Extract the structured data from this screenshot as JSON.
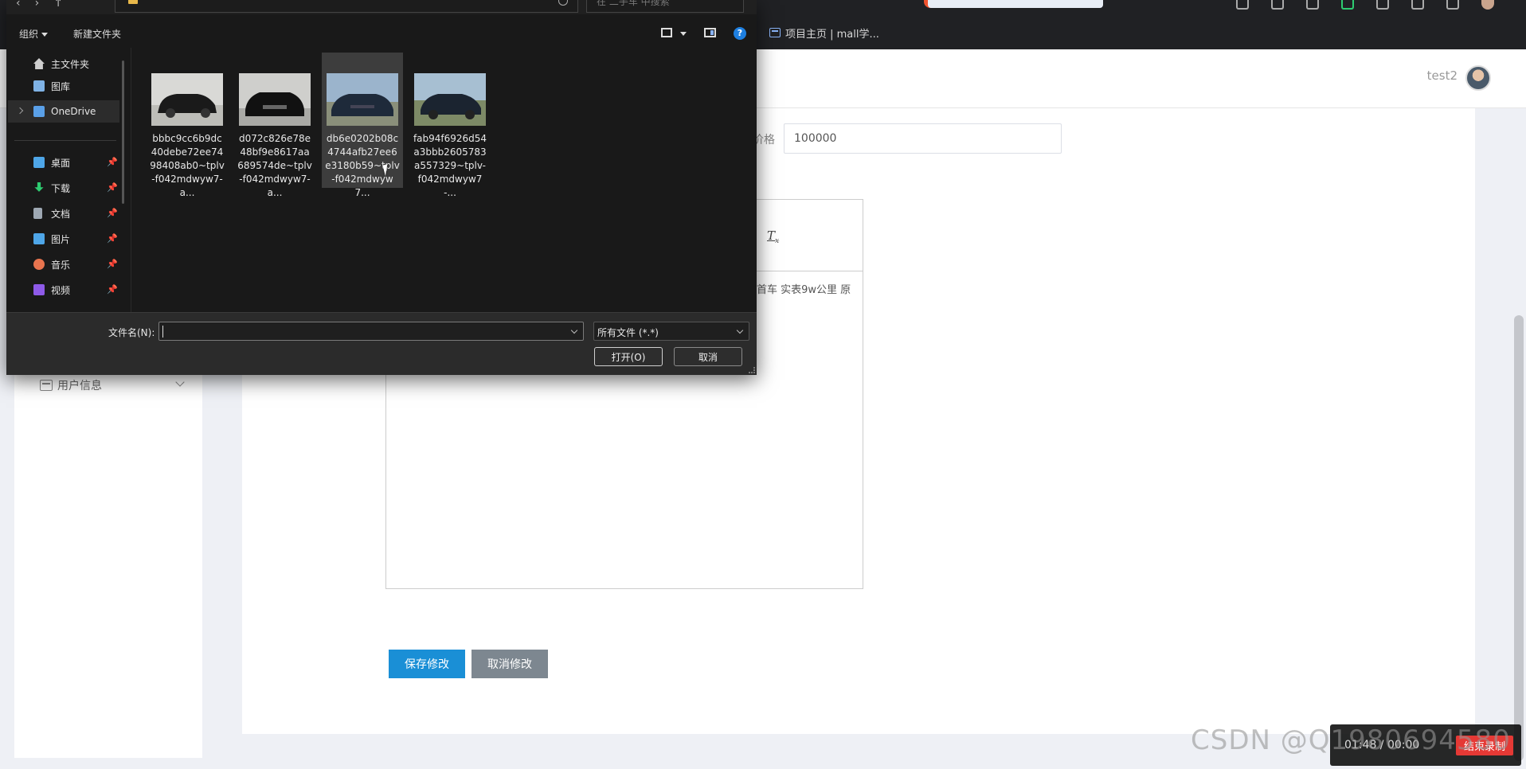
{
  "browser": {
    "bookmark_label": "项目主页 | mall学..."
  },
  "page": {
    "username": "test2",
    "price_label": "价格",
    "price_value": "100000",
    "editor_text": "首车 实表9w公里 原",
    "editor_clear_glyph": "T",
    "editor_clear_sub": "x",
    "save_label": "保存修改",
    "cancel_label": "取消修改",
    "sidebar_user_info": "用户信息"
  },
  "dialog": {
    "organize_label": "组织",
    "new_folder_label": "新建文件夹",
    "help_glyph": "?",
    "search_placeholder": "在 二手车 中搜索",
    "nav": {
      "items": [
        {
          "label": "主文件夹",
          "color": "#e6e6e6"
        },
        {
          "label": "图库",
          "color": "#7fb2e5"
        },
        {
          "label": "OneDrive",
          "color": "#5aa0e8"
        },
        {
          "label": "桌面",
          "color": "#4ea6e8"
        },
        {
          "label": "下载",
          "color": "#2ecc71"
        },
        {
          "label": "文档",
          "color": "#9ea8b3"
        },
        {
          "label": "图片",
          "color": "#4ea6e8"
        },
        {
          "label": "音乐",
          "color": "#e8744e"
        },
        {
          "label": "视频",
          "color": "#8e5ae8"
        }
      ]
    },
    "files": [
      {
        "name": "bbbc9cc6b9dc40debe72ee7498408ab0~tplv-f042mdwyw7-a...",
        "selected": false
      },
      {
        "name": "d072c826e78e48bf9e8617aa689574de~tplv-f042mdwyw7-a...",
        "selected": false
      },
      {
        "name": "db6e0202b08c4744afb27ee6e3180b59~tplv-f042mdwyw7...",
        "selected": true
      },
      {
        "name": "fab94f6926d54a3bbb2605783a557329~tplv-f042mdwyw7-...",
        "selected": false
      }
    ],
    "filename_label": "文件名(N):",
    "filename_value": "",
    "file_filter": "所有文件 (*.*)",
    "open_label": "打开(O)",
    "cancel_label": "取消"
  },
  "overlay": {
    "watermark": "CSDN @Q1980694580",
    "record_time": "01:48 / 00:00",
    "record_button": "结束录制"
  }
}
